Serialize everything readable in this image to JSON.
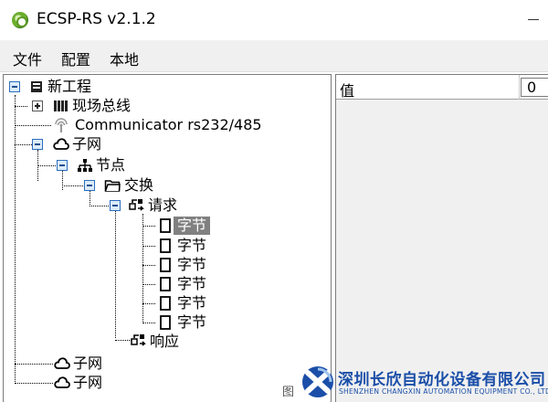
{
  "window": {
    "title": "ECSP-RS v2.1.2"
  },
  "menu": [
    {
      "label": "文件"
    },
    {
      "label": "配置"
    },
    {
      "label": "本地"
    }
  ],
  "tree": {
    "root": {
      "label": "新工程"
    },
    "fieldbus": {
      "label": "现场总线"
    },
    "communicator": {
      "label": "Communicator rs232/485"
    },
    "subnet1": {
      "label": "子网"
    },
    "node": {
      "label": "节点"
    },
    "exchange": {
      "label": "交换"
    },
    "request": {
      "label": "请求"
    },
    "bytes": [
      "字节",
      "字节",
      "字节",
      "字节",
      "字节",
      "字节"
    ],
    "response": {
      "label": "响应"
    },
    "subnet2": {
      "label": "子网"
    },
    "subnet3": {
      "label": "子网"
    }
  },
  "properties": {
    "label": "值",
    "value": "0"
  },
  "footer": {
    "glyph": "图",
    "company_cn": "深圳长欣自动化设备有限公司",
    "company_en": "SHENZHEN CHANGXIN AUTOMATION EQUIPMENT CO., LTD"
  },
  "colors": {
    "brand": "#1a4ea8",
    "selection": "#808080",
    "toggle_border": "#2c6dbd"
  }
}
